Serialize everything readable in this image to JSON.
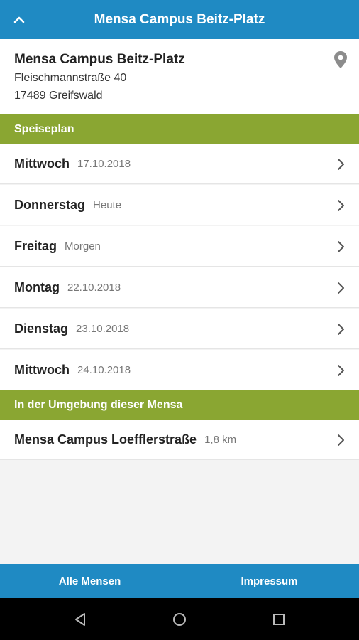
{
  "header": {
    "title": "Mensa Campus Beitz-Platz"
  },
  "info": {
    "name": "Mensa Campus Beitz-Platz",
    "street": "Fleischmannstraße 40",
    "city": "17489 Greifswald"
  },
  "sections": {
    "speiseplan": "Speiseplan",
    "nearby": "In der Umgebung dieser Mensa"
  },
  "days": [
    {
      "day": "Mittwoch",
      "sub": "17.10.2018"
    },
    {
      "day": "Donnerstag",
      "sub": "Heute"
    },
    {
      "day": "Freitag",
      "sub": "Morgen"
    },
    {
      "day": "Montag",
      "sub": "22.10.2018"
    },
    {
      "day": "Dienstag",
      "sub": "23.10.2018"
    },
    {
      "day": "Mittwoch",
      "sub": "24.10.2018"
    }
  ],
  "nearby": [
    {
      "name": "Mensa Campus Loefflerstraße",
      "distance": "1,8 km"
    }
  ],
  "bottom": {
    "left": "Alle Mensen",
    "right": "Impressum"
  },
  "colors": {
    "primary": "#1f8ac3",
    "section": "#8aa632"
  }
}
